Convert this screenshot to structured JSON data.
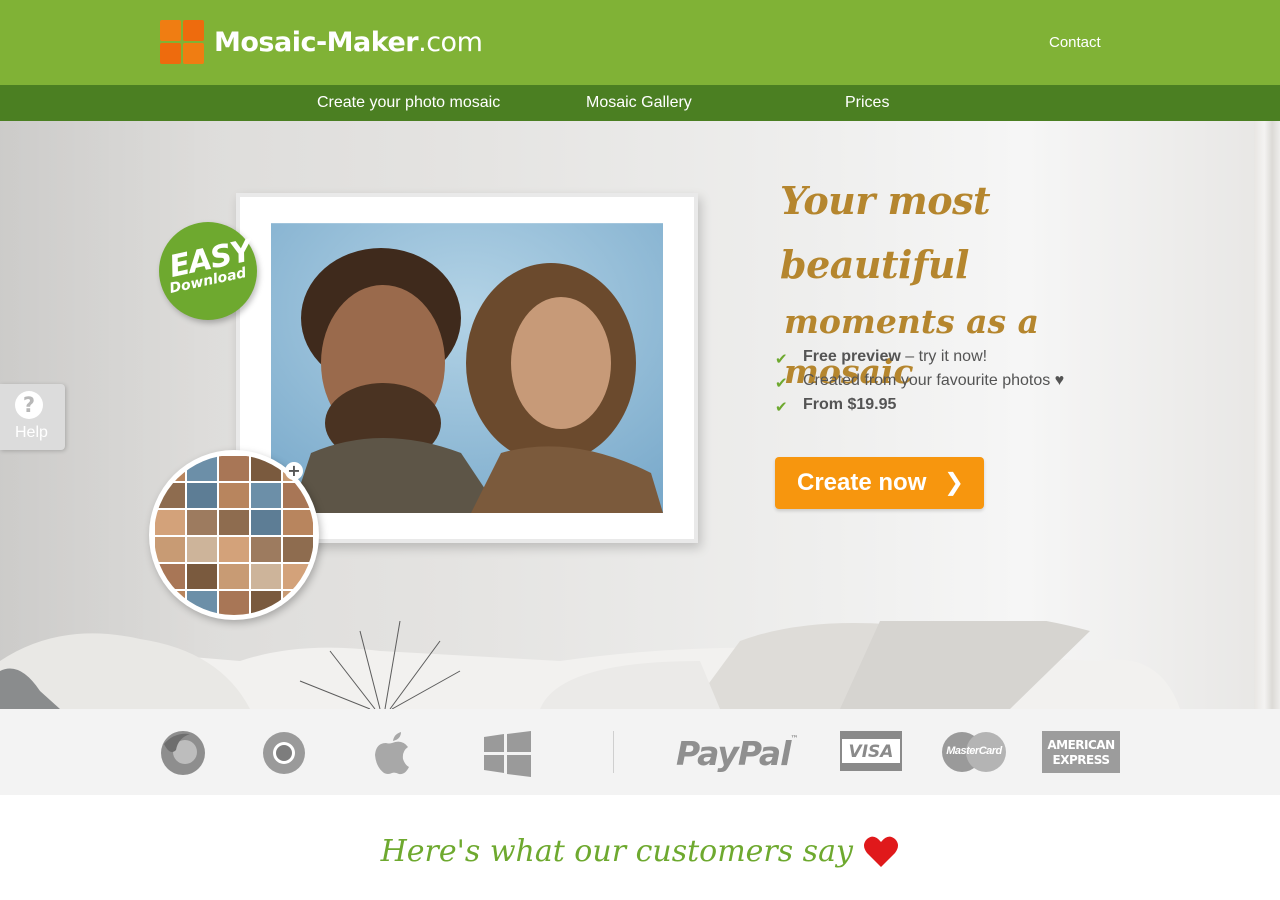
{
  "header": {
    "logo_brand": "Mosaic-Maker",
    "logo_tld": ".com",
    "contact_label": "Contact"
  },
  "nav": {
    "items": [
      {
        "label": "Create your photo mosaic"
      },
      {
        "label": "Mosaic Gallery"
      },
      {
        "label": "Prices"
      }
    ]
  },
  "hero": {
    "badge_main": "EASY",
    "badge_sub": "Download",
    "help_label": "Help",
    "help_icon_glyph": "?",
    "headline_line1": "Your most beautiful",
    "headline_line2": "moments as a mosaic",
    "features": [
      {
        "bold": "Free preview",
        "rest": " – try it now!"
      },
      {
        "bold": "",
        "rest": "Created from your favourite photos ♥"
      },
      {
        "bold": "From $19.95",
        "rest": ""
      }
    ],
    "cta_label": "Create now",
    "cta_icon": "chevron-right-icon"
  },
  "logos": {
    "browsers": [
      "firefox-icon",
      "chrome-icon",
      "apple-icon",
      "windows-icon"
    ],
    "paypal": "PayPal",
    "paypal_tm": "™",
    "visa": "VISA",
    "mastercard": "MasterCard",
    "amex_line1": "AMERICAN",
    "amex_line2": "EXPRESS"
  },
  "testimonials": {
    "heading": "Here's what our customers say"
  },
  "colors": {
    "header_green": "#80b236",
    "nav_green": "#4b7f22",
    "accent_orange": "#f7960e",
    "headline_gold": "#b5862e",
    "check_green": "#6ea92f"
  }
}
